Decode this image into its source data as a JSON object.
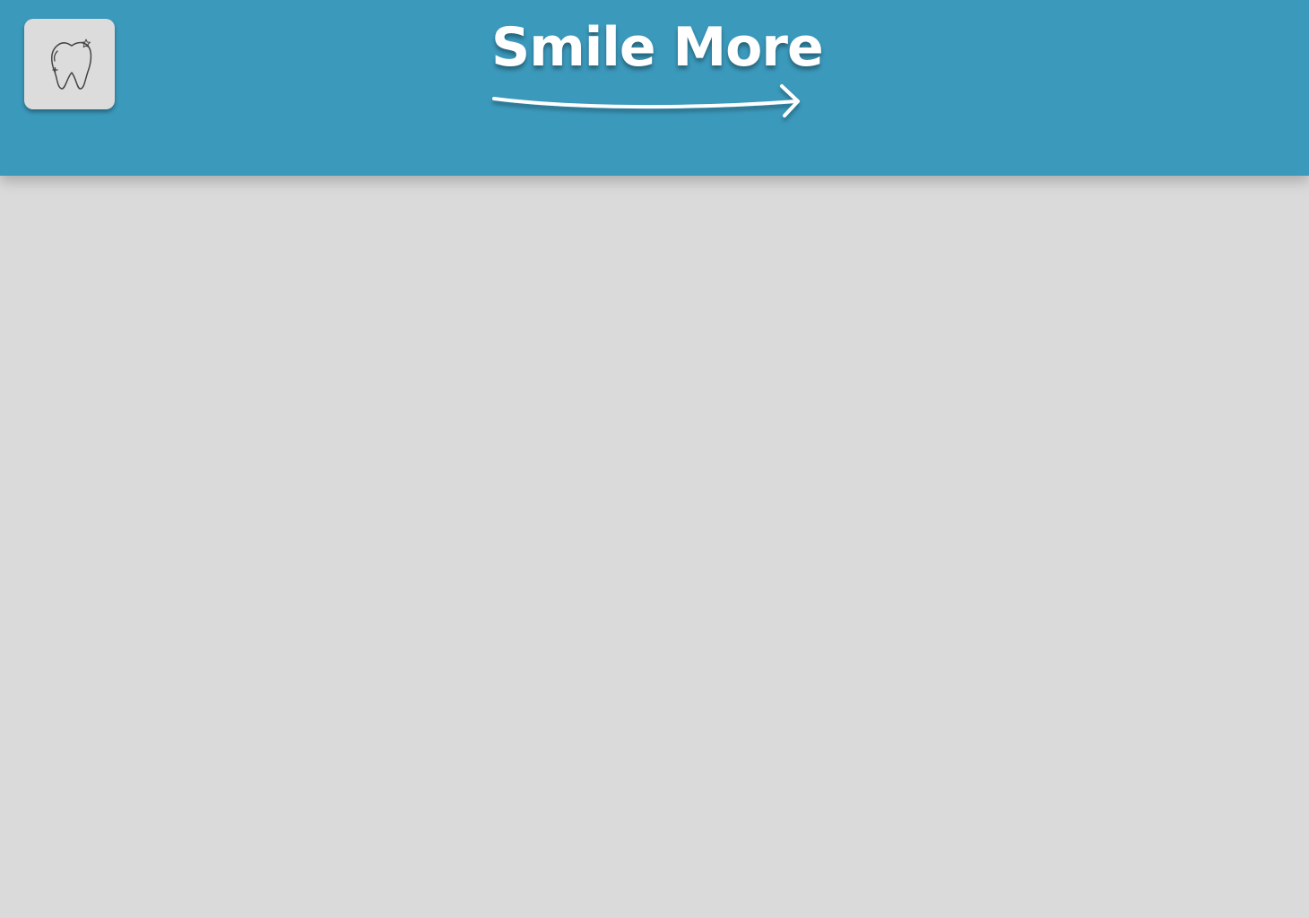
{
  "header": {
    "background_color": "#3b99bc",
    "logo": {
      "icon": "tooth-icon",
      "background_color": "#dcdcdc"
    },
    "brand": {
      "title": "Smile More",
      "decoration_icon": "arrow-right-icon",
      "text_color": "#ffffff"
    }
  },
  "main": {
    "background_color": "#dadada"
  }
}
